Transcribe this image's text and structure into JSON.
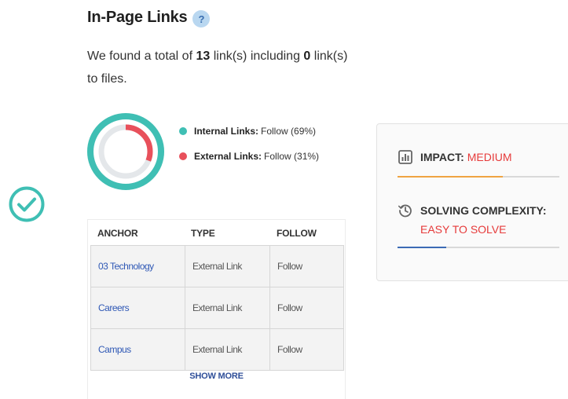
{
  "header": {
    "title": "In-Page Links",
    "help_glyph": "?"
  },
  "summary": {
    "prefix": "We found a total of ",
    "total": "13",
    "middle": " link(s) including ",
    "files": "0",
    "suffix": " link(s) to files."
  },
  "donut": {
    "internal_pct": 69,
    "external_pct": 31,
    "internal_color": "#3fbfb4",
    "external_color": "#e8505b"
  },
  "legend": [
    {
      "label": "Internal Links:",
      "value": "Follow (69%)",
      "color": "#3fbfb4"
    },
    {
      "label": "External Links:",
      "value": "Follow (31%)",
      "color": "#e8505b"
    }
  ],
  "table": {
    "columns": [
      "ANCHOR",
      "TYPE",
      "FOLLOW"
    ],
    "rows": [
      {
        "anchor": "03 Technology",
        "type": "External Link",
        "follow": "Follow"
      },
      {
        "anchor": "Careers",
        "type": "External Link",
        "follow": "Follow"
      },
      {
        "anchor": "Campus",
        "type": "External Link",
        "follow": "Follow"
      }
    ],
    "show_more": "SHOW MORE"
  },
  "impact": {
    "label": "IMPACT:",
    "value": "MEDIUM",
    "level": 0.65,
    "bar_color": "#f0a441",
    "icon": "bar-chart-icon"
  },
  "complexity": {
    "label": "SOLVING COMPLEXITY:",
    "value": "EASY TO SOLVE",
    "level": 0.3,
    "bar_color": "#3c6bb5",
    "icon": "history-icon"
  },
  "status": {
    "icon": "check-circle-icon",
    "color": "#3fbfb4"
  }
}
